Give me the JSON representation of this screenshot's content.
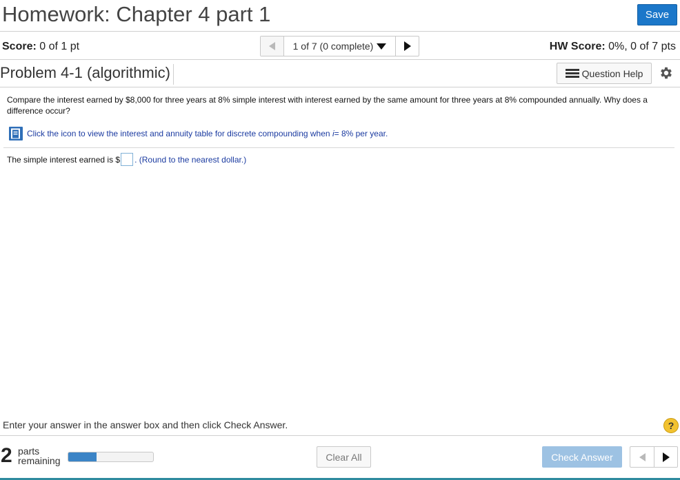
{
  "header": {
    "title": "Homework: Chapter 4 part 1",
    "save_label": "Save"
  },
  "score_bar": {
    "score_label": "Score:",
    "score_value": "0 of 1 pt",
    "question_selector": "1 of 7 (0 complete)",
    "hw_score_label": "HW Score:",
    "hw_score_value": "0%, 0 of 7 pts"
  },
  "problem": {
    "title": "Problem 4-1 (algorithmic)",
    "question_help_label": "Question Help",
    "question_text": "Compare the interest earned by $8,000 for three years at 8% simple interest with interest earned by the same amount for three years at 8% compounded annually. Why does a difference occur?",
    "table_link_text": "Click the icon to view the interest and annuity table for discrete compounding when",
    "table_link_var": "i",
    "table_link_rate": " = 8% per year.",
    "answer_prefix": "The simple interest earned is $",
    "answer_value": "",
    "answer_suffix": ". (Round to the nearest dollar.)"
  },
  "footer": {
    "instruction": "Enter your answer in the answer box and then click Check Answer.",
    "help_symbol": "?",
    "parts_count": "2",
    "parts_label_line1": "parts",
    "parts_label_line2": "remaining",
    "progress_fraction": 0.33,
    "clear_all_label": "Clear All",
    "check_answer_label": "Check Answer"
  },
  "colors": {
    "accent": "#1b77c9",
    "link": "#1a3aa0",
    "check_disabled": "#9dc2e3",
    "help_yellow": "#f2c230",
    "progress_fill": "#3b84c6"
  },
  "icons": {
    "question_help": "list-icon",
    "settings": "gear-icon",
    "table": "book-icon",
    "help": "question-circle-icon"
  }
}
